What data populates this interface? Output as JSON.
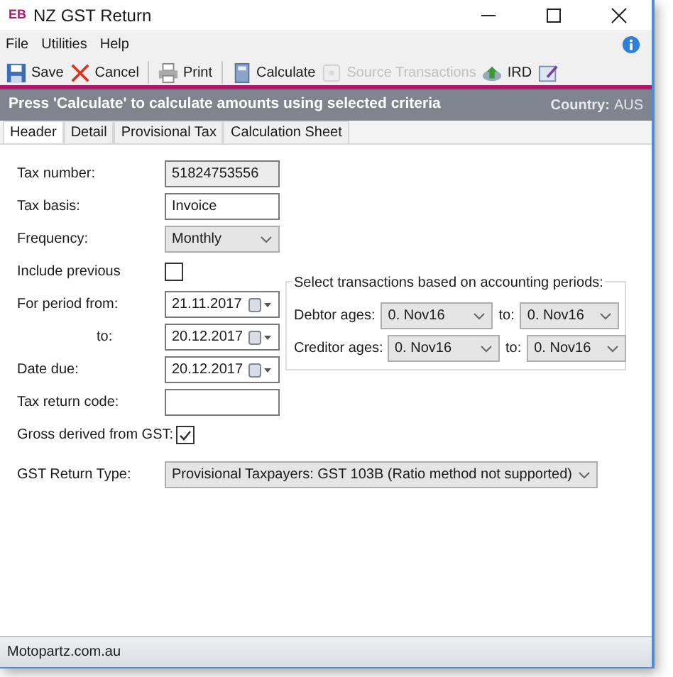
{
  "window": {
    "logo": "EB",
    "title": "NZ GST Return"
  },
  "menu": [
    "File",
    "Utilities",
    "Help"
  ],
  "toolbar": [
    {
      "kind": "save",
      "label": "Save",
      "disabled": false
    },
    {
      "kind": "cancel",
      "label": "Cancel",
      "disabled": false
    },
    {
      "kind": "separator"
    },
    {
      "kind": "print",
      "label": "Print",
      "disabled": false
    },
    {
      "kind": "separator"
    },
    {
      "kind": "calculate",
      "label": "Calculate",
      "disabled": false
    },
    {
      "kind": "source",
      "label": "Source Transactions",
      "disabled": true
    },
    {
      "kind": "ird",
      "label": "IRD",
      "disabled": false
    },
    {
      "kind": "edit",
      "disabled": false
    }
  ],
  "banner": {
    "message": "Press 'Calculate' to calculate amounts using selected criteria",
    "country_label": "Country:",
    "country": "AUS"
  },
  "tabs": [
    {
      "label": "Header",
      "selected": true
    },
    {
      "label": "Detail",
      "selected": false
    },
    {
      "label": "Provisional Tax",
      "selected": false
    },
    {
      "label": "Calculation Sheet",
      "selected": false
    }
  ],
  "form": [
    {
      "kind": "text",
      "label": "Tax number:",
      "value": "51824753556",
      "disabled": true
    },
    {
      "kind": "text",
      "label": "Tax basis:",
      "value": "Invoice",
      "disabled": false
    },
    {
      "kind": "select",
      "label": "Frequency:",
      "value": "Monthly"
    },
    {
      "kind": "checkbox",
      "label": "Include previous",
      "checked": false
    },
    {
      "kind": "date",
      "label": "For period from:",
      "value": "21.11.2017"
    },
    {
      "kind": "date_end",
      "label": "to:",
      "value": "20.12.2017"
    },
    {
      "kind": "date",
      "label": "Date due:",
      "value": "20.12.2017"
    },
    {
      "kind": "text",
      "label": "Tax return code:",
      "disabled": false
    },
    {
      "kind": "checkbox",
      "label": "Gross derived from GST:",
      "checked": true
    }
  ],
  "periods": {
    "title": "Select transactions based on accounting periods:",
    "rows": [
      {
        "label": "Debtor ages:",
        "from": "0. Nov16",
        "to_label": "to:",
        "to": "0. Nov16"
      },
      {
        "label": "Creditor ages:",
        "from": "0. Nov16",
        "to_label": "to:",
        "to": "0. Nov16"
      }
    ]
  },
  "return_type": {
    "label": "GST Return Type:",
    "value": "Provisional Taxpayers: GST 103B (Ratio method not supported)"
  },
  "status_bar": "Motopartz.com.au"
}
